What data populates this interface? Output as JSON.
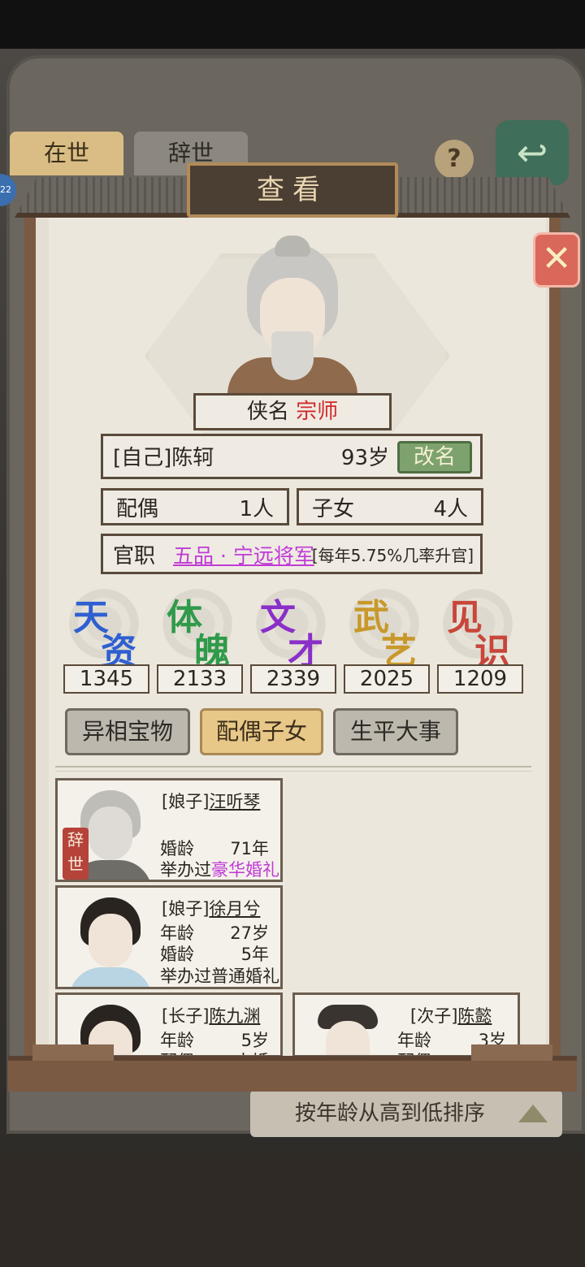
{
  "background": {
    "tab_active": "在世",
    "tab_inactive": "辞世",
    "help_icon": "question-icon",
    "return_icon": "return-arrow-icon",
    "badge": "22",
    "sort_label": "按年龄从高到低排序"
  },
  "dialog": {
    "title": "查看",
    "close_icon": "close-x-icon"
  },
  "profile": {
    "title_label": "侠名",
    "title_value": "宗师",
    "relation_name": "[自己]陈轲",
    "age": "93岁",
    "rename_label": "改名",
    "spouse_label": "配偶",
    "spouse_count": "1人",
    "children_label": "子女",
    "children_count": "4人",
    "office_label": "官职",
    "office_value": "五品 · 宁远将军",
    "office_rate": "[每年5.75%几率升官]"
  },
  "attributes": [
    {
      "c1": "天",
      "c2": "资",
      "value": "1345",
      "color": "#2f5fd0"
    },
    {
      "c1": "体",
      "c2": "魄",
      "value": "2133",
      "color": "#2f9a4a"
    },
    {
      "c1": "文",
      "c2": "才",
      "value": "2339",
      "color": "#8a2fc8"
    },
    {
      "c1": "武",
      "c2": "艺",
      "value": "2025",
      "color": "#c8982a"
    },
    {
      "c1": "见",
      "c2": "识",
      "value": "1209",
      "color": "#c8463a"
    }
  ],
  "tabs": [
    {
      "label": "异相宝物",
      "active": false
    },
    {
      "label": "配偶子女",
      "active": true
    },
    {
      "label": "生平大事",
      "active": false
    }
  ],
  "cards": [
    {
      "relation": "[娘子]",
      "name": "汪听琴",
      "deceased_badge": "辞世",
      "lines": [
        {
          "label": "婚龄",
          "value": "71年"
        },
        {
          "label": "举办过",
          "value": "豪华婚礼"
        }
      ]
    },
    {
      "relation": "[娘子]",
      "name": "徐月兮",
      "lines": [
        {
          "label": "年龄",
          "value": "27岁"
        },
        {
          "label": "婚龄",
          "value": "5年"
        },
        {
          "label": "举办过普通婚礼",
          "value": ""
        }
      ]
    },
    {
      "relation": "[长子]",
      "name": "陈九渊",
      "lines": [
        {
          "label": "年龄",
          "value": "5岁"
        },
        {
          "label": "配偶",
          "value": "未婚"
        }
      ]
    },
    {
      "relation": "[次子]",
      "name": "陈懿",
      "lines": [
        {
          "label": "年龄",
          "value": "3岁"
        },
        {
          "label": "配偶",
          "value": "未婚"
        }
      ]
    }
  ]
}
